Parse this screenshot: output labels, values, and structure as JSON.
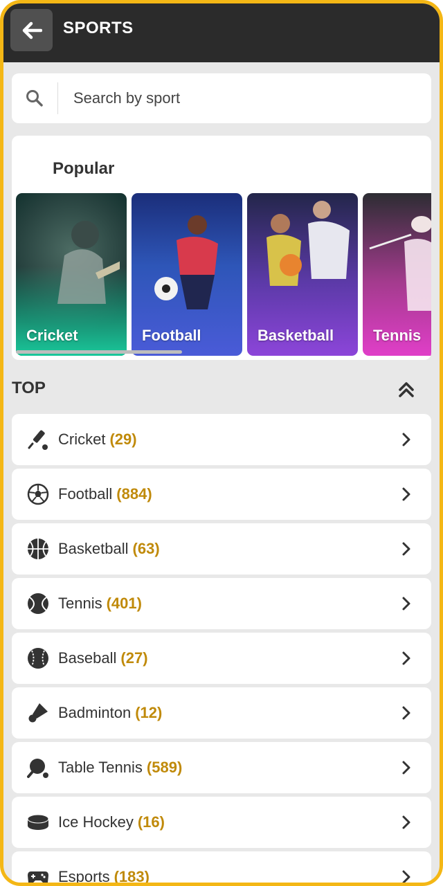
{
  "header": {
    "title": "SPORTS",
    "back_icon": "arrow-left-icon"
  },
  "search": {
    "placeholder": "Search by sport",
    "icon": "search-icon"
  },
  "popular": {
    "title": "Popular",
    "cards": [
      {
        "label": "Cricket",
        "color": "#1fb58f"
      },
      {
        "label": "Football",
        "color": "#4a5bd8"
      },
      {
        "label": "Basketball",
        "color": "#8c45d9"
      },
      {
        "label": "Tennis",
        "color": "#e03ec8"
      }
    ]
  },
  "top_section": {
    "label": "TOP",
    "toggle_icon": "chevrons-up-icon"
  },
  "sports": [
    {
      "name": "Cricket",
      "count": "(29)",
      "icon": "cricket-icon"
    },
    {
      "name": "Football",
      "count": "(884)",
      "icon": "football-icon"
    },
    {
      "name": "Basketball",
      "count": "(63)",
      "icon": "basketball-icon"
    },
    {
      "name": "Tennis",
      "count": "(401)",
      "icon": "tennis-icon"
    },
    {
      "name": "Baseball",
      "count": "(27)",
      "icon": "baseball-icon"
    },
    {
      "name": "Badminton",
      "count": "(12)",
      "icon": "badminton-icon"
    },
    {
      "name": "Table Tennis",
      "count": "(589)",
      "icon": "table-tennis-icon"
    },
    {
      "name": "Ice Hockey",
      "count": "(16)",
      "icon": "ice-hockey-icon"
    },
    {
      "name": "Esports",
      "count": "(183)",
      "icon": "esports-icon"
    }
  ],
  "colors": {
    "accent": "#f4b715",
    "count": "#c08a0a",
    "header_bg": "#2b2b2b"
  }
}
